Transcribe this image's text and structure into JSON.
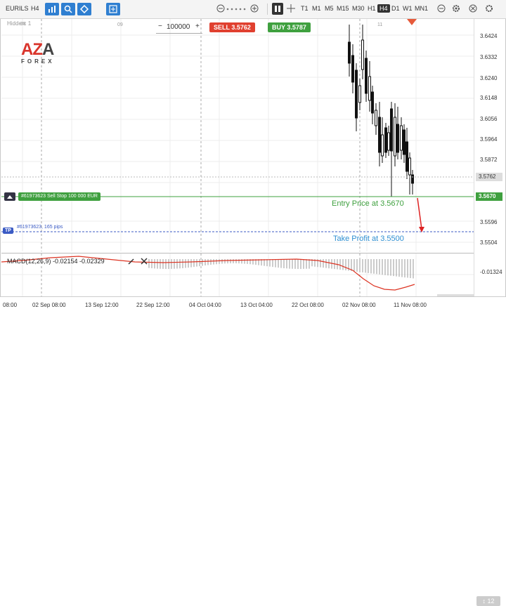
{
  "toolbar": {
    "symbol": "EURILS",
    "timeframe_current": "H4",
    "timeframes": [
      "T1",
      "M1",
      "M5",
      "M15",
      "M30",
      "H1",
      "H4",
      "D1",
      "W1",
      "MN1"
    ],
    "active_timeframe": "H4"
  },
  "chart": {
    "hidden_label": "Hidden: 1",
    "logo_text": "AZA",
    "logo_sub": "FOREX",
    "top_marks": [
      "08",
      "09",
      "11"
    ],
    "quantity": "100000",
    "sell_button": "SELL 3.5762",
    "buy_button": "BUY 3.5787",
    "order_label": "#61973623 Sell Stop 100 000 EUR",
    "tp_text": "#61973623, 165 pips",
    "tp_tag": "TP",
    "entry_annotation": "Entry Price at 3.5670",
    "tp_annotation": "Take Profit at 3.5500",
    "current_price_tag": "3.5762",
    "entry_price_tag": "3.5670",
    "price_axis": [
      "3.6424",
      "3.6332",
      "3.6240",
      "3.6148",
      "3.6056",
      "3.5964",
      "3.5872",
      "3.5762",
      "3.5670",
      "3.5596",
      "3.5504"
    ],
    "macd_label": "MACD(12,26,9) -0.02154 -0.02329",
    "macd_axis": "-0.01324",
    "time_axis": [
      "08:00",
      "02 Sep 08:00",
      "13 Sep 12:00",
      "22 Sep 12:00",
      "04 Oct 04:00",
      "13 Oct 04:00",
      "22 Oct 08:00",
      "02 Nov 08:00",
      "11 Nov 08:00"
    ],
    "scroll_value": "12",
    "colors": {
      "sell": "#e0402f",
      "buy": "#3fa03f",
      "accent": "#2f7fd1",
      "tp": "#3b5bc4"
    }
  }
}
